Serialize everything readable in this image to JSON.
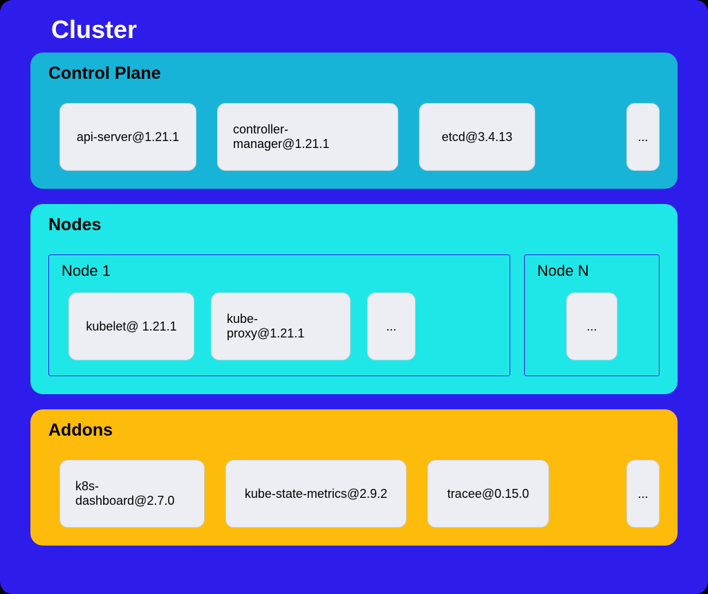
{
  "cluster": {
    "title": "Cluster"
  },
  "control_plane": {
    "title": "Control Plane",
    "items": [
      "api-server@1.21.1",
      "controller-manager@1.21.1",
      "etcd@3.4.13"
    ],
    "more": "..."
  },
  "nodes": {
    "title": "Nodes",
    "node1": {
      "title": "Node 1",
      "items": [
        "kubelet@ 1.21.1",
        "kube-proxy@1.21.1"
      ],
      "more": "..."
    },
    "nodeN": {
      "title": "Node N",
      "more": "..."
    }
  },
  "addons": {
    "title": "Addons",
    "items": [
      "k8s-dashboard@2.7.0",
      "kube-state-metrics@2.9.2",
      "tracee@0.15.0"
    ],
    "more": "..."
  }
}
